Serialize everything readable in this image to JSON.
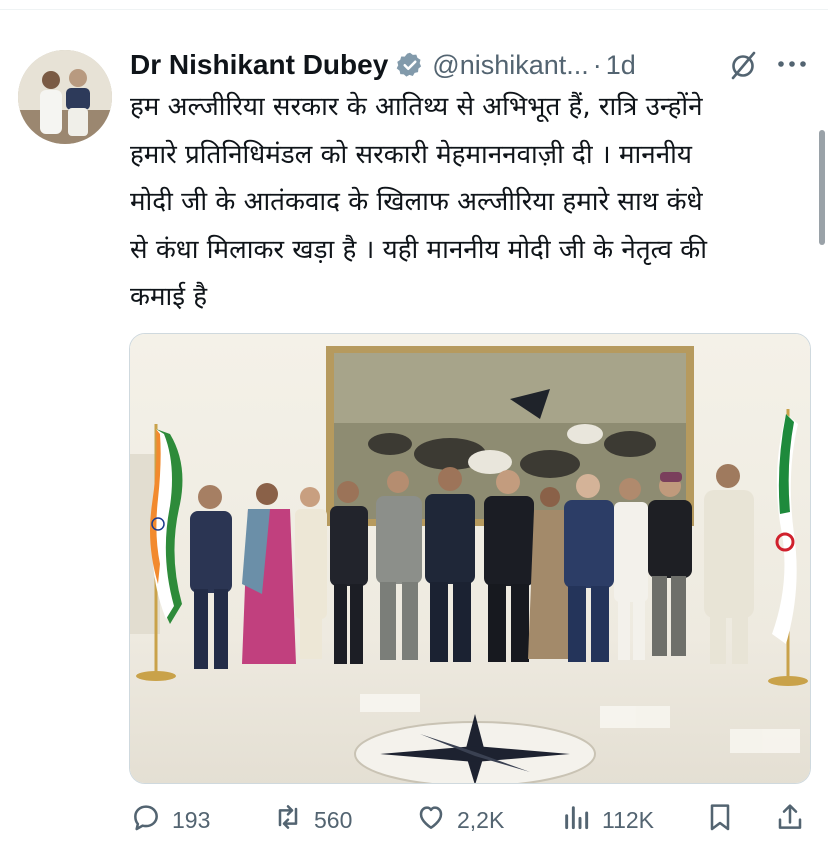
{
  "post": {
    "author_name": "Dr Nishikant Dubey",
    "handle": "@nishikant...",
    "separator": "·",
    "time": "1d",
    "text_lines": [
      "हम अल्जीरिया सरकार के आतिथ्य से अभिभूत हैं, रात्रि उन्होंने",
      "हमारे प्रतिनिधिमंडल को सरकारी मेहमाननवाज़ी दी । माननीय",
      "मोदी जी के आतंकवाद के खिलाफ अल्जीरिया हमारे साथ कंधे",
      "से कंधा मिलाकर खड़ा है । यही माननीय मोदी जी के नेतृत्व की",
      "कमाई है"
    ],
    "verified_icon": "verified-badge-icon",
    "grok_icon": "slashed-circle-icon",
    "more_icon": "more-dots-icon"
  },
  "actions": {
    "replies": "193",
    "reposts": "560",
    "likes": "2,2K",
    "views": "112K",
    "icons": [
      "reply-icon",
      "repost-icon",
      "like-icon",
      "views-icon",
      "bookmark-icon",
      "share-icon"
    ]
  },
  "colors": {
    "text": "#0f1419",
    "secondary": "#536471",
    "border": "#cfd9de",
    "verified": "#829aab"
  }
}
